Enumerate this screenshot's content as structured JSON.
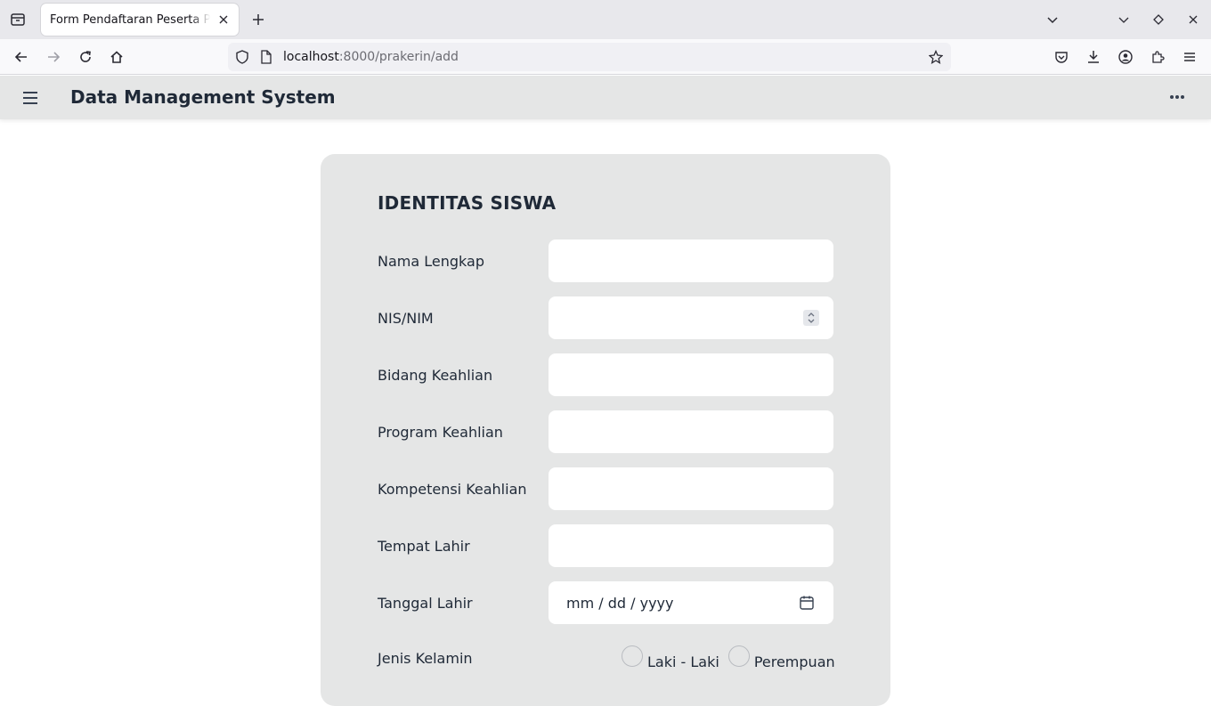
{
  "browser": {
    "tab_title": "Form Pendaftaran Peserta Prakerin",
    "url_host": "localhost",
    "url_path": ":8000/prakerin/add"
  },
  "app": {
    "title": "Data Management System"
  },
  "form": {
    "section_title": "IDENTITAS SISWA",
    "fields": {
      "nama_lengkap": {
        "label": "Nama Lengkap",
        "value": ""
      },
      "nis": {
        "label": "NIS/NIM",
        "value": ""
      },
      "bidang": {
        "label": "Bidang Keahlian",
        "value": ""
      },
      "program": {
        "label": "Program Keahlian",
        "value": ""
      },
      "kompetensi": {
        "label": "Kompetensi Keahlian",
        "value": ""
      },
      "tempat_lahir": {
        "label": "Tempat Lahir",
        "value": ""
      },
      "tanggal_lahir": {
        "label": "Tanggal Lahir",
        "placeholder": "mm / dd / yyyy"
      },
      "jenis_kelamin": {
        "label": "Jenis Kelamin",
        "options": [
          "Laki - Laki",
          "Perempuan"
        ]
      }
    }
  },
  "colors": {
    "card_bg": "#e5e6e6",
    "appbar_bg": "#e5e6e6",
    "text": "#1f2937"
  }
}
